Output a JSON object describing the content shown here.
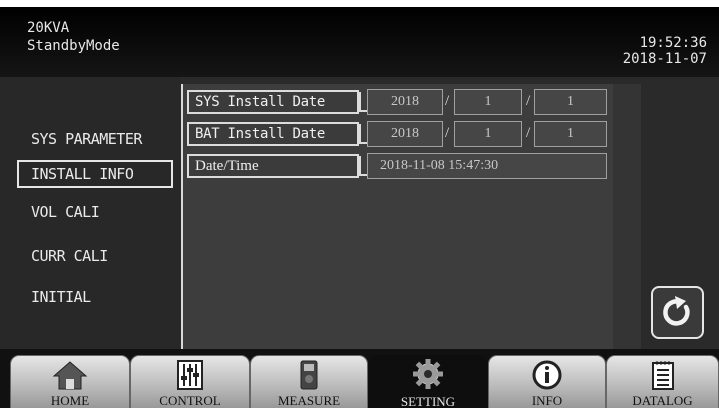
{
  "header": {
    "model": "20KVA",
    "mode": "StandbyMode",
    "time": "19:52:36",
    "date": "2018-11-07"
  },
  "sidebar": {
    "items": [
      {
        "label": "SYS PARAMETER",
        "selected": false
      },
      {
        "label": "INSTALL INFO",
        "selected": true
      },
      {
        "label": "VOL CALI",
        "selected": false
      },
      {
        "label": "CURR CALI",
        "selected": false
      },
      {
        "label": "INITIAL",
        "selected": false
      }
    ]
  },
  "panel": {
    "sys_install_date": {
      "label": "SYS Install Date",
      "year": "2018",
      "month": "1",
      "day": "1"
    },
    "bat_install_date": {
      "label": "BAT Install Date",
      "year": "2018",
      "month": "1",
      "day": "1"
    },
    "date_time": {
      "label": "Date/Time",
      "value": "2018-11-08 15:47:30"
    },
    "separator": "/"
  },
  "icons": {
    "refresh": "refresh-icon"
  },
  "tabs": [
    {
      "label": "HOME",
      "icon": "home-icon",
      "active": false
    },
    {
      "label": "CONTROL",
      "icon": "control-sliders-icon",
      "active": false
    },
    {
      "label": "MEASURE",
      "icon": "meter-icon",
      "active": false
    },
    {
      "label": "SETTING",
      "icon": "gear-icon",
      "active": true
    },
    {
      "label": "INFO",
      "icon": "info-icon",
      "active": false
    },
    {
      "label": "DATALOG",
      "icon": "datalog-icon",
      "active": false
    }
  ]
}
